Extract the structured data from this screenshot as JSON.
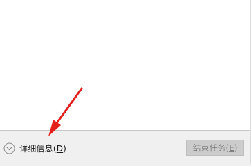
{
  "footer": {
    "details_toggle": {
      "label": "详细信息",
      "accelerator_open": "(",
      "accelerator_key": "D",
      "accelerator_close": ")",
      "icon": "chevron-down-circle-icon"
    },
    "end_task_button": {
      "label": "结束任务",
      "accelerator_open": "(",
      "accelerator_key": "E",
      "accelerator_close": ")",
      "enabled": false
    }
  },
  "annotation": {
    "icon": "red-arrow-icon",
    "color": "#e3201b"
  },
  "colors": {
    "content_background": "#ffffff",
    "footer_background": "#f0f0f0",
    "disabled_button": "#cccccc",
    "disabled_text": "#7f7f7f"
  }
}
